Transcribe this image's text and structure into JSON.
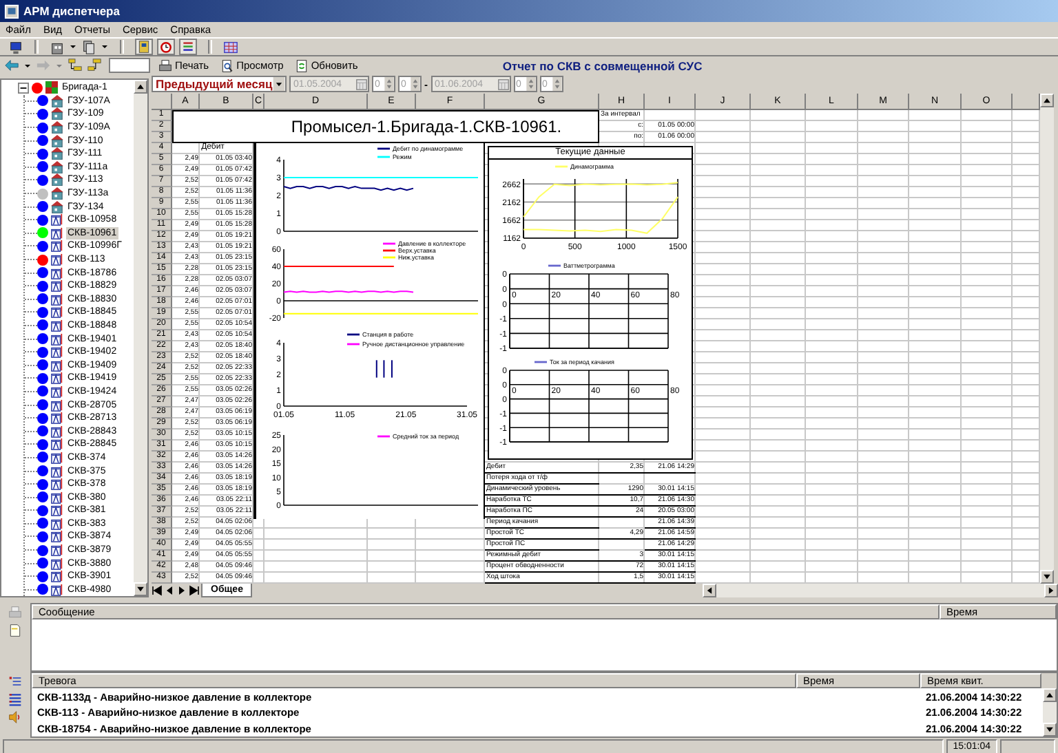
{
  "window": {
    "title": "АРМ диспетчера"
  },
  "menu": [
    "Файл",
    "Вид",
    "Отчеты",
    "Сервис",
    "Справка"
  ],
  "report_toolbar": {
    "buttons": [
      "Печать",
      "Просмотр",
      "Обновить"
    ],
    "title": "Отчет по СКВ с совмещенной СУС"
  },
  "period": {
    "preset": "Предыдущий месяц",
    "disabled": true,
    "from": {
      "date": "01.05.2004",
      "hour": "0",
      "minute": "0"
    },
    "separator": "-",
    "to": {
      "date": "01.06.2004",
      "hour": "0",
      "minute": "0"
    }
  },
  "tree": {
    "root": {
      "label": "Бригада-1",
      "color": "#ff0000",
      "expanded": true,
      "selected": false,
      "children": [
        {
          "label": "ГЗУ-107А",
          "kind": "gzu",
          "color": "#0000ff",
          "selected": false
        },
        {
          "label": "ГЗУ-109",
          "kind": "gzu",
          "color": "#0000ff",
          "selected": false
        },
        {
          "label": "ГЗУ-109А",
          "kind": "gzu",
          "color": "#0000ff",
          "selected": false
        },
        {
          "label": "ГЗУ-110",
          "kind": "gzu",
          "color": "#0000ff",
          "selected": false
        },
        {
          "label": "ГЗУ-111",
          "kind": "gzu",
          "color": "#0000ff",
          "selected": false
        },
        {
          "label": "ГЗУ-111а",
          "kind": "gzu",
          "color": "#0000ff",
          "selected": false
        },
        {
          "label": "ГЗУ-113",
          "kind": "gzu",
          "color": "#0000ff",
          "selected": false
        },
        {
          "label": "ГЗУ-113а",
          "kind": "gzu",
          "color": "#c0c0c0",
          "selected": false
        },
        {
          "label": "ГЗУ-134",
          "kind": "gzu",
          "color": "#0000ff",
          "selected": false
        },
        {
          "label": "СКВ-10958",
          "kind": "skv",
          "color": "#0000ff",
          "selected": false
        },
        {
          "label": "СКВ-10961",
          "kind": "skv",
          "color": "#00ff00",
          "selected": true
        },
        {
          "label": "СКВ-10996Г",
          "kind": "skv",
          "color": "#0000ff",
          "selected": false
        },
        {
          "label": "СКВ-113",
          "kind": "skv",
          "color": "#ff0000",
          "selected": false
        },
        {
          "label": "СКВ-18786",
          "kind": "skv",
          "color": "#0000ff",
          "selected": false
        },
        {
          "label": "СКВ-18829",
          "kind": "skv",
          "color": "#0000ff",
          "selected": false
        },
        {
          "label": "СКВ-18830",
          "kind": "skv",
          "color": "#0000ff",
          "selected": false
        },
        {
          "label": "СКВ-18845",
          "kind": "skv",
          "color": "#0000ff",
          "selected": false
        },
        {
          "label": "СКВ-18848",
          "kind": "skv",
          "color": "#0000ff",
          "selected": false
        },
        {
          "label": "СКВ-19401",
          "kind": "skv",
          "color": "#0000ff",
          "selected": false
        },
        {
          "label": "СКВ-19402",
          "kind": "skv",
          "color": "#0000ff",
          "selected": false
        },
        {
          "label": "СКВ-19409",
          "kind": "skv",
          "color": "#0000ff",
          "selected": false
        },
        {
          "label": "СКВ-19419",
          "kind": "skv",
          "color": "#0000ff",
          "selected": false
        },
        {
          "label": "СКВ-19424",
          "kind": "skv",
          "color": "#0000ff",
          "selected": false
        },
        {
          "label": "СКВ-28705",
          "kind": "skv",
          "color": "#0000ff",
          "selected": false
        },
        {
          "label": "СКВ-28713",
          "kind": "skv",
          "color": "#0000ff",
          "selected": false
        },
        {
          "label": "СКВ-28843",
          "kind": "skv",
          "color": "#0000ff",
          "selected": false
        },
        {
          "label": "СКВ-28845",
          "kind": "skv",
          "color": "#0000ff",
          "selected": false
        },
        {
          "label": "СКВ-374",
          "kind": "skv",
          "color": "#0000ff",
          "selected": false
        },
        {
          "label": "СКВ-375",
          "kind": "skv",
          "color": "#0000ff",
          "selected": false
        },
        {
          "label": "СКВ-378",
          "kind": "skv",
          "color": "#0000ff",
          "selected": false
        },
        {
          "label": "СКВ-380",
          "kind": "skv",
          "color": "#0000ff",
          "selected": false
        },
        {
          "label": "СКВ-381",
          "kind": "skv",
          "color": "#0000ff",
          "selected": false
        },
        {
          "label": "СКВ-383",
          "kind": "skv",
          "color": "#0000ff",
          "selected": false
        },
        {
          "label": "СКВ-3874",
          "kind": "skv",
          "color": "#0000ff",
          "selected": false
        },
        {
          "label": "СКВ-3879",
          "kind": "skv",
          "color": "#0000ff",
          "selected": false
        },
        {
          "label": "СКВ-3880",
          "kind": "skv",
          "color": "#0000ff",
          "selected": false
        },
        {
          "label": "СКВ-3901",
          "kind": "skv",
          "color": "#0000ff",
          "selected": false
        },
        {
          "label": "СКВ-4980",
          "kind": "skv",
          "color": "#0000ff",
          "selected": false
        }
      ]
    }
  },
  "sheet": {
    "columns": [
      "A",
      "B",
      "C",
      "D",
      "E",
      "F",
      "G",
      "H",
      "I",
      "J",
      "K",
      "L",
      "M",
      "N",
      "O"
    ],
    "row_numbers": [
      "1",
      "2",
      "3",
      "4",
      "5",
      "6",
      "7",
      "8",
      "9",
      "10",
      "11",
      "12",
      "13",
      "14",
      "15",
      "16",
      "17",
      "18",
      "19",
      "20",
      "21",
      "22",
      "23",
      "24",
      "25",
      "26",
      "27",
      "28",
      "29",
      "30",
      "31",
      "32",
      "33",
      "34",
      "35",
      "36",
      "37",
      "38",
      "39",
      "40",
      "41",
      "42",
      "43"
    ],
    "title": "Промысел-1.Бригада-1.СКВ-10961.",
    "interval": {
      "label": "За интервал",
      "from_label": "с:",
      "from_value": "01.05 00:00",
      "to_label": "по:",
      "to_value": "01.06 00:00"
    },
    "debit_header": "Дебит",
    "debit_rows": [
      {
        "value": "2,49",
        "time": "01.05 03:40"
      },
      {
        "value": "2,49",
        "time": "01.05 07:42"
      },
      {
        "value": "2,52",
        "time": "01.05 07:42"
      },
      {
        "value": "2,52",
        "time": "01.05 11:36"
      },
      {
        "value": "2,55",
        "time": "01.05 11:36"
      },
      {
        "value": "2,55",
        "time": "01.05 15:28"
      },
      {
        "value": "2,49",
        "time": "01.05 15:28"
      },
      {
        "value": "2,49",
        "time": "01.05 19:21"
      },
      {
        "value": "2,43",
        "time": "01.05 19:21"
      },
      {
        "value": "2,43",
        "time": "01.05 23:15"
      },
      {
        "value": "2,28",
        "time": "01.05 23:15"
      },
      {
        "value": "2,28",
        "time": "02.05 03:07"
      },
      {
        "value": "2,46",
        "time": "02.05 03:07"
      },
      {
        "value": "2,46",
        "time": "02.05 07:01"
      },
      {
        "value": "2,55",
        "time": "02.05 07:01"
      },
      {
        "value": "2,55",
        "time": "02.05 10:54"
      },
      {
        "value": "2,43",
        "time": "02.05 10:54"
      },
      {
        "value": "2,43",
        "time": "02.05 18:40"
      },
      {
        "value": "2,52",
        "time": "02.05 18:40"
      },
      {
        "value": "2,52",
        "time": "02.05 22:33"
      },
      {
        "value": "2,55",
        "time": "02.05 22:33"
      },
      {
        "value": "2,55",
        "time": "03.05 02:26"
      },
      {
        "value": "2,47",
        "time": "03.05 02:26"
      },
      {
        "value": "2,47",
        "time": "03.05 06:19"
      },
      {
        "value": "2,52",
        "time": "03.05 06:19"
      },
      {
        "value": "2,52",
        "time": "03.05 10:15"
      },
      {
        "value": "2,46",
        "time": "03.05 10:15"
      },
      {
        "value": "2,46",
        "time": "03.05 14:26"
      },
      {
        "value": "2,46",
        "time": "03.05 14:26"
      },
      {
        "value": "2,46",
        "time": "03.05 18:19"
      },
      {
        "value": "2,46",
        "time": "03.05 18:19"
      },
      {
        "value": "2,46",
        "time": "03.05 22:11"
      },
      {
        "value": "2,52",
        "time": "03.05 22:11"
      },
      {
        "value": "2,52",
        "time": "04.05 02:06"
      },
      {
        "value": "2,49",
        "time": "04.05 02:06"
      },
      {
        "value": "2,49",
        "time": "04.05 05:55"
      },
      {
        "value": "2,49",
        "time": "04.05 05:55"
      },
      {
        "value": "2,48",
        "time": "04.05 09:46"
      },
      {
        "value": "2,52",
        "time": "04.05 09:46"
      }
    ],
    "charts": [
      {
        "chart_data": {
          "type": "line",
          "legend": "upper right",
          "categories": [
            null,
            null,
            null,
            null,
            null,
            null,
            null,
            null,
            null,
            null,
            null,
            null,
            null,
            null,
            null,
            null,
            null,
            null,
            null,
            null,
            null,
            null,
            null,
            null,
            null,
            null,
            null,
            null,
            null,
            null,
            null
          ],
          "ylim": [
            0,
            4
          ],
          "yticks": [
            0,
            1,
            2,
            3,
            4
          ],
          "series": [
            {
              "name": "Дебит по динамограмме",
              "color": "#000080",
              "values": [
                2.5,
                2.4,
                2.5,
                2.5,
                2.4,
                2.5,
                2.5,
                2.4,
                2.5,
                2.5,
                2.4,
                2.5,
                2.4,
                2.4,
                2.4,
                2.3,
                2.4,
                2.3,
                2.4,
                2.3,
                2.4,
                null,
                null,
                null,
                null,
                null,
                null,
                null,
                null,
                null,
                null
              ]
            },
            {
              "name": "Режим",
              "color": "#00ffff",
              "values": [
                3,
                3,
                3,
                3,
                3,
                3,
                3,
                3,
                3,
                3,
                3,
                3,
                3,
                3,
                3,
                3,
                3,
                3,
                3,
                3,
                3,
                3,
                3,
                3,
                3,
                3,
                3,
                3,
                3,
                3,
                3
              ]
            }
          ]
        }
      },
      {
        "chart_data": {
          "type": "line",
          "legend": "upper right",
          "categories": [
            null,
            null,
            null,
            null,
            null,
            null,
            null,
            null,
            null,
            null,
            null,
            null,
            null,
            null,
            null,
            null,
            null,
            null,
            null,
            null,
            null,
            null,
            null,
            null,
            null,
            null,
            null,
            null,
            null,
            null,
            null
          ],
          "ylim": [
            -20,
            60
          ],
          "yticks": [
            -20,
            0,
            20,
            40,
            60
          ],
          "series": [
            {
              "name": "Давление в коллекторе",
              "color": "#ff00ff",
              "values": [
                10,
                11,
                10,
                11,
                10,
                10,
                11,
                10,
                11,
                11,
                10,
                11,
                10,
                11,
                11,
                10,
                11,
                10,
                11,
                11,
                10,
                null,
                null,
                null,
                null,
                null,
                null,
                null,
                null,
                null,
                null
              ]
            },
            {
              "name": "Верх.уставка",
              "color": "#ff0000",
              "values": [
                40,
                40,
                40,
                40,
                40,
                40,
                40,
                40,
                40,
                40,
                40,
                40,
                40,
                40,
                40,
                40,
                40,
                40,
                null,
                null,
                null,
                null,
                null,
                null,
                null,
                null,
                null,
                null,
                null,
                null,
                null
              ]
            },
            {
              "name": "Ниж.уставка",
              "color": "#ffff00",
              "values": [
                -15,
                -15,
                -15,
                -15,
                -15,
                -15,
                -15,
                -15,
                -15,
                -15,
                -15,
                -15,
                -15,
                -15,
                -15,
                -15,
                -15,
                -15,
                -15,
                -15,
                -15,
                -15,
                -15,
                -15,
                -15,
                -15,
                -15,
                -15,
                -15,
                -15,
                -15
              ]
            }
          ]
        }
      },
      {
        "chart_data": {
          "type": "line",
          "legend": "upper right",
          "categories": [
            "01.05",
            null,
            null,
            null,
            null,
            null,
            null,
            null,
            null,
            null,
            "11.05",
            null,
            null,
            null,
            null,
            null,
            null,
            null,
            null,
            null,
            "21.05",
            null,
            null,
            null,
            null,
            null,
            null,
            null,
            null,
            null,
            "31.05"
          ],
          "ylim": [
            0,
            4
          ],
          "yticks": [
            0,
            1,
            2,
            3,
            4
          ],
          "series": [
            {
              "name": "Станция в работе",
              "color": "#000080",
              "values": [
                null,
                null,
                null,
                null,
                null,
                null,
                null,
                null,
                null,
                null,
                null,
                null,
                null,
                null,
                null,
                null,
                null,
                null,
                null,
                null,
                null,
                null,
                null,
                null,
                null,
                null,
                null,
                null,
                null,
                null,
                null
              ]
            },
            {
              "name": "Ручное дистанционное управление",
              "color": "#ff00ff",
              "values": [
                null,
                null,
                null,
                null,
                null,
                null,
                null,
                null,
                null,
                null,
                null,
                null,
                null,
                null,
                null,
                null,
                null,
                null,
                null,
                null,
                null,
                null,
                null,
                null,
                null,
                null,
                null,
                null,
                null,
                null,
                null
              ]
            }
          ]
        }
      },
      {
        "chart_data": {
          "type": "line",
          "legend": "upper right",
          "categories": [
            null,
            null,
            null,
            null,
            null,
            null,
            null,
            null,
            null,
            null,
            null,
            null,
            null,
            null,
            null,
            null,
            null,
            null,
            null,
            null,
            null,
            null,
            null,
            null,
            null,
            null,
            null,
            null,
            null,
            null,
            null
          ],
          "ylim": [
            0,
            25
          ],
          "yticks": [
            0,
            5,
            10,
            15,
            20,
            25
          ],
          "series": [
            {
              "name": "Средний ток за период",
              "color": "#ff00ff",
              "values": [
                null,
                null,
                null,
                null,
                null,
                null,
                null,
                null,
                null,
                null,
                null,
                null,
                null,
                null,
                null,
                null,
                null,
                null,
                null,
                null,
                null,
                null,
                null,
                null,
                null,
                null,
                null,
                null,
                null,
                null,
                null
              ]
            }
          ]
        }
      }
    ],
    "current": {
      "title": "Текущие данные",
      "charts": [
        {
          "chart_data": {
            "type": "line",
            "legend": "top",
            "grid": true,
            "x": [
              0,
              150,
              300,
              450,
              600,
              750,
              900,
              1050,
              1200,
              1350,
              1500
            ],
            "xlim": [
              0,
              1500
            ],
            "ylim": [
              1162,
              2800
            ],
            "yticks": [
              1162,
              1662,
              2162,
              2662
            ],
            "xticks": [
              0,
              500,
              1000,
              1500
            ],
            "series": [
              {
                "name": "Динамограмма",
                "color": "#ffff66",
                "values": [
                  1750,
                  2300,
                  2650,
                  2620,
                  2660,
                  2640,
                  2650,
                  2660,
                  2640,
                  2650,
                  2700
                ]
              },
              {
                "color": "#ffff66",
                "values": [
                  1400,
                  1400,
                  1380,
                  1360,
                  1380,
                  1350,
                  1400,
                  1380,
                  1300,
                  1700,
                  2300
                ]
              }
            ]
          }
        },
        {
          "chart_data": {
            "type": "line",
            "legend": "top",
            "grid": true,
            "categories": [
              "0",
              "20",
              "40",
              "60",
              "80"
            ],
            "ylim": [
              -1.35,
              0.4
            ],
            "yticks": [
              {
                "value": 0.4,
                "label": "0"
              },
              {
                "value": 0.05,
                "label": "0"
              },
              {
                "value": -0.3,
                "label": "0"
              },
              {
                "value": -0.65,
                "label": "-1"
              },
              {
                "value": -1,
                "label": "-1"
              },
              {
                "value": -1.35,
                "label": "-1"
              }
            ],
            "series": [
              {
                "name": "Ваттметрограмма",
                "color": "#6666cc",
                "values": [
                  null,
                  null,
                  null,
                  null,
                  null
                ]
              }
            ]
          }
        },
        {
          "chart_data": {
            "type": "line",
            "legend": "top",
            "grid": true,
            "categories": [
              "0",
              "20",
              "40",
              "60",
              "80"
            ],
            "ylim": [
              -1.35,
              0.4
            ],
            "yticks": [
              {
                "value": 0.4,
                "label": "0"
              },
              {
                "value": 0.05,
                "label": "0"
              },
              {
                "value": -0.3,
                "label": "0"
              },
              {
                "value": -0.65,
                "label": "-1"
              },
              {
                "value": -1,
                "label": "-1"
              },
              {
                "value": -1.35,
                "label": "-1"
              }
            ],
            "series": [
              {
                "name": "Ток за период качания",
                "color": "#6666cc",
                "values": [
                  null,
                  null,
                  null,
                  null,
                  null
                ]
              }
            ]
          }
        }
      ],
      "rows": [
        {
          "name": "Дебит",
          "value": "2,35",
          "time": "21.06 14:29"
        },
        {
          "name": "Потеря хода от т/ф"
        },
        {
          "name": "Динамический уровень",
          "value": "1290",
          "time": "30.01 14:15"
        },
        {
          "name": "Наработка ТС",
          "value": "10,7",
          "time": "21.06 14:30"
        },
        {
          "name": "Наработка ПС",
          "value": "24",
          "time": "20.05 03:00"
        },
        {
          "name": "Период качания",
          "time": "21.06 14:39"
        },
        {
          "name": "Простой ТС",
          "value": "4,29",
          "time": "21.06 14:59"
        },
        {
          "name": "Простой ПС",
          "time": "21.06 14:29"
        },
        {
          "name": "Режимный дебит",
          "value": "3",
          "time": "30.01 14:15"
        },
        {
          "name": "Процент обводненности",
          "value": "72",
          "time": "30.01 14:15"
        },
        {
          "name": "Ход штока",
          "value": "1,5",
          "time": "30.01 14:15"
        }
      ]
    },
    "sheet_tabs": [
      {
        "label": "Общее",
        "selected": true
      }
    ]
  },
  "messages": {
    "columns": [
      "Сообщение",
      "Время"
    ]
  },
  "alarms": {
    "columns": [
      "Тревога",
      "Время",
      "Время квит."
    ],
    "rows": [
      {
        "text": "СКВ-1133д - Аварийно-низкое давление в коллекторе",
        "ack_time": "21.06.2004 14:30:22"
      },
      {
        "text": "СКВ-113 - Аварийно-низкое давление в коллекторе",
        "ack_time": "21.06.2004 14:30:22"
      },
      {
        "text": "СКВ-18754 - Аварийно-низкое давление в коллекторе",
        "ack_time": "21.06.2004 14:30:22"
      }
    ]
  },
  "status_bar": {
    "clock": "15:01:04"
  }
}
